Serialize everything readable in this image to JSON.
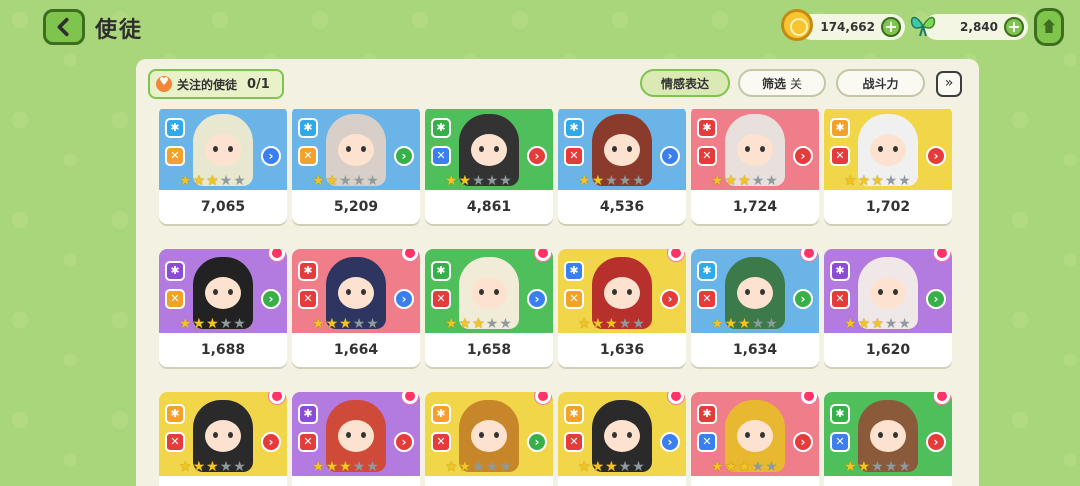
{
  "header": {
    "title": "使徒",
    "gold": "174,662",
    "gems": "2,840"
  },
  "toolbar": {
    "follow_label": "关注的使徒",
    "follow_count": "0/1",
    "emotion_label": "情感表达",
    "filter_label": "筛选",
    "filter_state": "关",
    "power_label": "战斗力",
    "expand_icon": "double-chevron-down-icon"
  },
  "cards": [
    {
      "power": "7,065",
      "stars": 3,
      "bg": "#6ab4e8",
      "hair": "#e8e8d0",
      "elem": "#2fa9e8",
      "cls": "#f2a12b",
      "arrow": "#3a7ff0",
      "flower": false
    },
    {
      "power": "5,209",
      "stars": 2,
      "bg": "#6ab4e8",
      "hair": "#d8d0c8",
      "elem": "#2fa9e8",
      "cls": "#f2a12b",
      "arrow": "#38b04a",
      "flower": false
    },
    {
      "power": "4,861",
      "stars": 2,
      "bg": "#4fbf5c",
      "hair": "#333333",
      "elem": "#38b04a",
      "cls": "#3a7ff0",
      "arrow": "#e53b3b",
      "flower": false
    },
    {
      "power": "4,536",
      "stars": 2,
      "bg": "#6ab4e8",
      "hair": "#8a3b2c",
      "elem": "#2fa9e8",
      "cls": "#e53b3b",
      "arrow": "#3a7ff0",
      "flower": false
    },
    {
      "power": "1,724",
      "stars": 3,
      "bg": "#f07d8a",
      "hair": "#e8e0dc",
      "elem": "#e53b3b",
      "cls": "#e53b3b",
      "arrow": "#e53b3b",
      "flower": false
    },
    {
      "power": "1,702",
      "stars": 3,
      "bg": "#f2d64a",
      "hair": "#f0f0f0",
      "elem": "#f2a12b",
      "cls": "#e53b3b",
      "arrow": "#e53b3b",
      "flower": false
    },
    {
      "power": "1,688",
      "stars": 3,
      "bg": "#b37be0",
      "hair": "#222222",
      "elem": "#8b4cd6",
      "cls": "#f2a12b",
      "arrow": "#38b04a",
      "flower": true
    },
    {
      "power": "1,664",
      "stars": 3,
      "bg": "#f07d8a",
      "hair": "#2e3560",
      "elem": "#e53b3b",
      "cls": "#e53b3b",
      "arrow": "#3a7ff0",
      "flower": true
    },
    {
      "power": "1,658",
      "stars": 3,
      "bg": "#4fbf5c",
      "hair": "#f0ecd8",
      "elem": "#38b04a",
      "cls": "#e53b3b",
      "arrow": "#3a7ff0",
      "flower": true
    },
    {
      "power": "1,636",
      "stars": 3,
      "bg": "#f2d64a",
      "hair": "#b8302c",
      "elem": "#3a7ff0",
      "cls": "#f2a12b",
      "arrow": "#e53b3b",
      "flower": true
    },
    {
      "power": "1,634",
      "stars": 3,
      "bg": "#6ab4e8",
      "hair": "#3c7a4a",
      "elem": "#2fa9e8",
      "cls": "#e53b3b",
      "arrow": "#38b04a",
      "flower": true
    },
    {
      "power": "1,620",
      "stars": 3,
      "bg": "#b37be0",
      "hair": "#f0e8e8",
      "elem": "#8b4cd6",
      "cls": "#e53b3b",
      "arrow": "#38b04a",
      "flower": true
    },
    {
      "power": "",
      "stars": 3,
      "bg": "#f2d64a",
      "hair": "#2a2a2a",
      "elem": "#f2a12b",
      "cls": "#e53b3b",
      "arrow": "#e53b3b",
      "flower": true
    },
    {
      "power": "",
      "stars": 3,
      "bg": "#b37be0",
      "hair": "#d04a3a",
      "elem": "#8b4cd6",
      "cls": "#e53b3b",
      "arrow": "#e53b3b",
      "flower": true
    },
    {
      "power": "",
      "stars": 2,
      "bg": "#f2d64a",
      "hair": "#c8862a",
      "elem": "#f2a12b",
      "cls": "#e53b3b",
      "arrow": "#38b04a",
      "flower": true
    },
    {
      "power": "",
      "stars": 3,
      "bg": "#f2d64a",
      "hair": "#2a2a2a",
      "elem": "#f2a12b",
      "cls": "#e53b3b",
      "arrow": "#3a7ff0",
      "flower": true
    },
    {
      "power": "",
      "stars": 3,
      "bg": "#f07d8a",
      "hair": "#e8b830",
      "elem": "#e53b3b",
      "cls": "#3a7ff0",
      "arrow": "#e53b3b",
      "flower": true
    },
    {
      "power": "",
      "stars": 2,
      "bg": "#4fbf5c",
      "hair": "#8a5a3a",
      "elem": "#38b04a",
      "cls": "#3a7ff0",
      "arrow": "#e53b3b",
      "flower": true
    }
  ]
}
